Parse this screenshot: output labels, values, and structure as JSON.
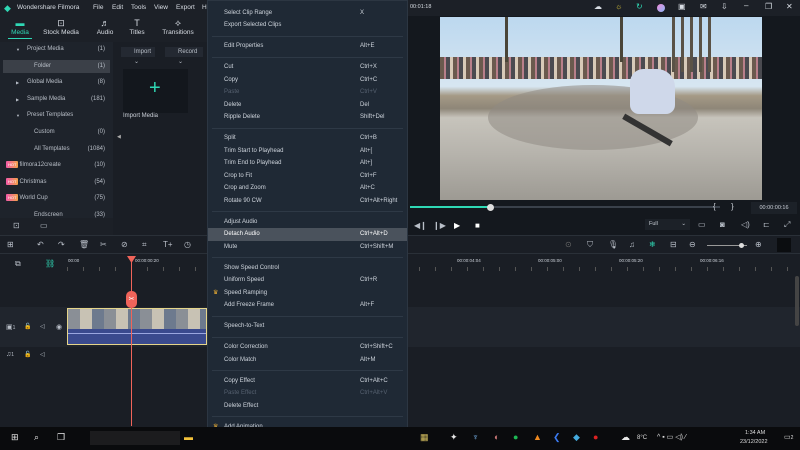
{
  "app": {
    "title": "Wondershare Filmora",
    "menu": [
      "File",
      "Edit",
      "Tools",
      "View",
      "Export",
      "H"
    ],
    "timecode_top": "00:01:18"
  },
  "tabs": [
    {
      "label": "Media",
      "icon": "media-icon",
      "active": true
    },
    {
      "label": "Stock Media",
      "icon": "stock-icon"
    },
    {
      "label": "Audio",
      "icon": "music-icon"
    },
    {
      "label": "Titles",
      "icon": "titles-icon"
    },
    {
      "label": "Transitions",
      "icon": "transitions-icon"
    }
  ],
  "library": [
    {
      "label": "Project Media",
      "count": "(1)",
      "arrow": "▼",
      "indent": 1
    },
    {
      "label": "Folder",
      "count": "(1)",
      "indent": 2,
      "selected": true
    },
    {
      "label": "Global Media",
      "count": "(8)",
      "arrow": "▶",
      "indent": 1
    },
    {
      "label": "Sample Media",
      "count": "(181)",
      "arrow": "▶",
      "indent": 1
    },
    {
      "label": "Preset Templates",
      "count": "",
      "arrow": "▼",
      "indent": 1
    },
    {
      "label": "Custom",
      "count": "(0)",
      "indent": 2
    },
    {
      "label": "All Templates",
      "count": "(1084)",
      "indent": 2
    },
    {
      "label": "filmora12create",
      "count": "(10)",
      "hot": "HOT",
      "indent": 1
    },
    {
      "label": "Christmas",
      "count": "(54)",
      "hot": "HOT",
      "indent": 1
    },
    {
      "label": "World Cup",
      "count": "(75)",
      "hot": "HOT",
      "indent": 1
    },
    {
      "label": "Endscreen",
      "count": "(33)",
      "indent": 2
    }
  ],
  "media": {
    "import_label": "Import",
    "record_label": "Record",
    "import_media": "Import Media"
  },
  "context_menu": [
    {
      "label": "Select Clip Range",
      "shortcut": "X"
    },
    {
      "label": "Export Selected Clips",
      "shortcut": ""
    },
    {
      "sep": true
    },
    {
      "label": "Edit Properties",
      "shortcut": "Alt+E"
    },
    {
      "sep": true
    },
    {
      "label": "Cut",
      "shortcut": "Ctrl+X"
    },
    {
      "label": "Copy",
      "shortcut": "Ctrl+C"
    },
    {
      "label": "Paste",
      "shortcut": "Ctrl+V",
      "disabled": true
    },
    {
      "label": "Delete",
      "shortcut": "Del"
    },
    {
      "label": "Ripple Delete",
      "shortcut": "Shift+Del"
    },
    {
      "sep": true
    },
    {
      "label": "Split",
      "shortcut": "Ctrl+B"
    },
    {
      "label": "Trim Start to Playhead",
      "shortcut": "Alt+["
    },
    {
      "label": "Trim End to Playhead",
      "shortcut": "Alt+]"
    },
    {
      "label": "Crop to Fit",
      "shortcut": "Ctrl+F"
    },
    {
      "label": "Crop and Zoom",
      "shortcut": "Alt+C"
    },
    {
      "label": "Rotate 90 CW",
      "shortcut": "Ctrl+Alt+Right"
    },
    {
      "sep": true
    },
    {
      "label": "Adjust Audio",
      "shortcut": ""
    },
    {
      "label": "Detach Audio",
      "shortcut": "Ctrl+Alt+D",
      "highlighted": true
    },
    {
      "label": "Mute",
      "shortcut": "Ctrl+Shift+M"
    },
    {
      "sep": true
    },
    {
      "label": "Show Speed Control",
      "shortcut": ""
    },
    {
      "label": "Uniform Speed",
      "shortcut": "Ctrl+R"
    },
    {
      "label": "Speed Ramping",
      "shortcut": "",
      "premium": true
    },
    {
      "label": "Add Freeze Frame",
      "shortcut": "Alt+F"
    },
    {
      "sep": true
    },
    {
      "label": "Speech-to-Text",
      "shortcut": ""
    },
    {
      "sep": true
    },
    {
      "label": "Color Correction",
      "shortcut": "Ctrl+Shift+C"
    },
    {
      "label": "Color Match",
      "shortcut": "Alt+M"
    },
    {
      "sep": true
    },
    {
      "label": "Copy Effect",
      "shortcut": "Ctrl+Alt+C"
    },
    {
      "label": "Paste Effect",
      "shortcut": "Ctrl+Alt+V",
      "disabled": true
    },
    {
      "label": "Delete Effect",
      "shortcut": ""
    },
    {
      "sep": true
    },
    {
      "label": "Add Animation",
      "shortcut": "",
      "premium": true
    }
  ],
  "preview": {
    "progress": 0.26,
    "timecode": "00:00:00:16",
    "quality": "Full",
    "mark_in": "{",
    "mark_out": "}"
  },
  "timeline": {
    "ruler": [
      "00:00",
      "00:00:00:20",
      "00:00:04:04",
      "00:00:05:00",
      "00:00:05:20",
      "00:00:06:16"
    ],
    "zoom_level": 0.85,
    "video_track": "1",
    "audio_track": "1"
  },
  "taskbar": {
    "time": "1:34 AM",
    "date": "23/12/2022",
    "weather": "8°C",
    "notifications": "2"
  },
  "colors": {
    "accent": "#2fd8b5",
    "playhead": "#f0645a",
    "menu_bg": "#1f2935"
  }
}
